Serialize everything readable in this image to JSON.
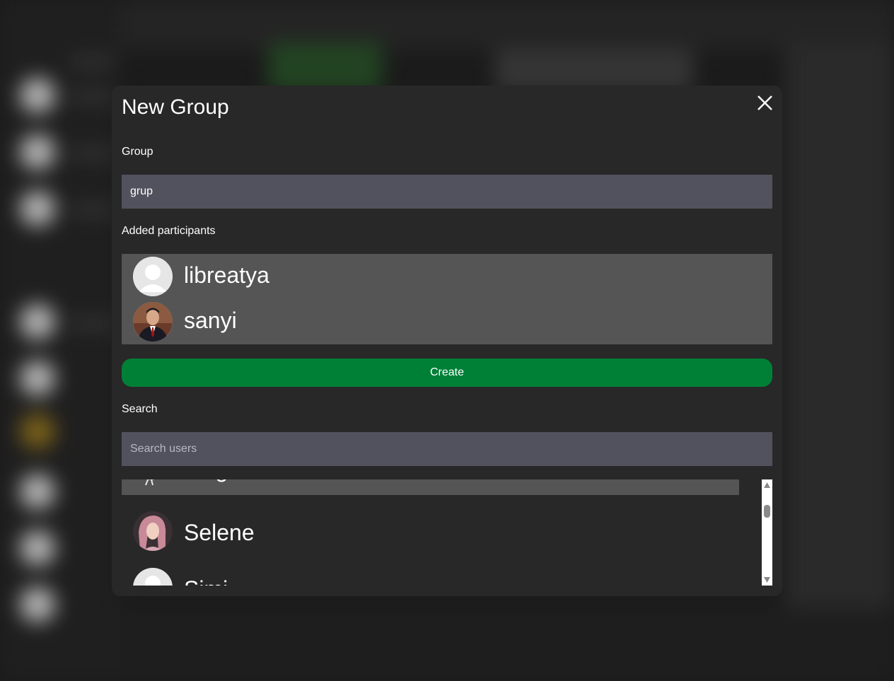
{
  "modal": {
    "title": "New Group",
    "group_label": "Group",
    "group_value": "grup",
    "participants_label": "Added participants",
    "participants": [
      {
        "name": "libreatya",
        "avatar": "default-avatar-icon"
      },
      {
        "name": "sanyi",
        "avatar": "man-in-suit-photo"
      }
    ],
    "create_label": "Create",
    "search_label": "Search",
    "search_placeholder": "Search users",
    "results": [
      {
        "name": "sergei",
        "avatar": "bird-sketch-photo",
        "selected": true
      },
      {
        "name": "Selene",
        "avatar": "woman-portrait-photo",
        "selected": false
      },
      {
        "name": "Simi",
        "avatar": "default-avatar-icon",
        "selected": false
      }
    ]
  },
  "colors": {
    "modal_bg": "#282828",
    "input_bg": "#52525e",
    "participants_bg": "#555555",
    "create_button": "#008037"
  }
}
